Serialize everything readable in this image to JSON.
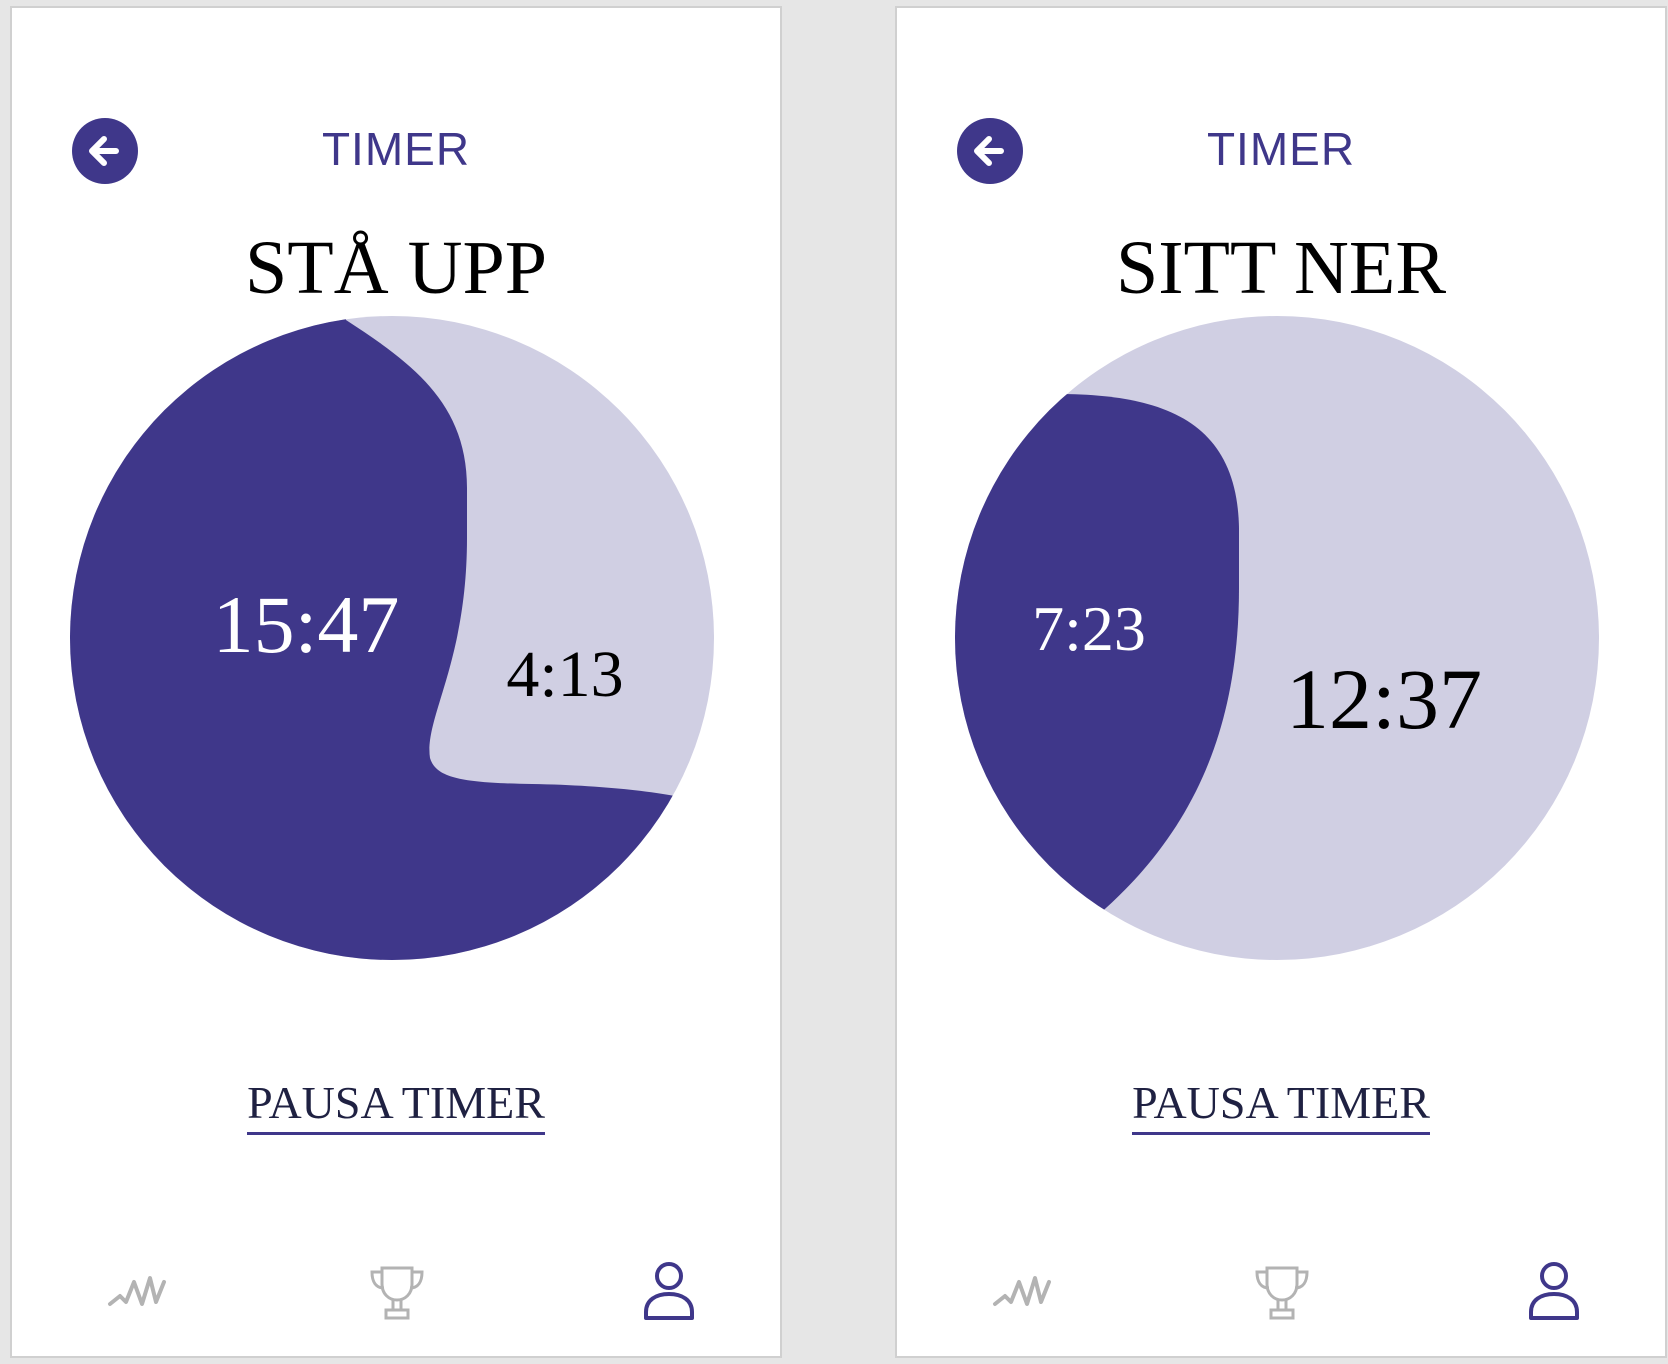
{
  "colors": {
    "accent": "#3f378a",
    "accent_light": "#d0cfe3",
    "inactive_icon": "#b3b3b3"
  },
  "screens": [
    {
      "header_title": "TIMER",
      "phase_title": "STÅ UPP",
      "elapsed_time": "15:47",
      "remaining_time": "4:13",
      "pause_label": "PAUSA TIMER",
      "nav": [
        "activity-icon",
        "trophy-icon",
        "profile-icon"
      ],
      "active_nav": "profile-icon"
    },
    {
      "header_title": "TIMER",
      "phase_title": "SITT NER",
      "elapsed_time": "7:23",
      "remaining_time": "12:37",
      "pause_label": "PAUSA TIMER",
      "nav": [
        "activity-icon",
        "trophy-icon",
        "profile-icon"
      ],
      "active_nav": "profile-icon"
    }
  ]
}
